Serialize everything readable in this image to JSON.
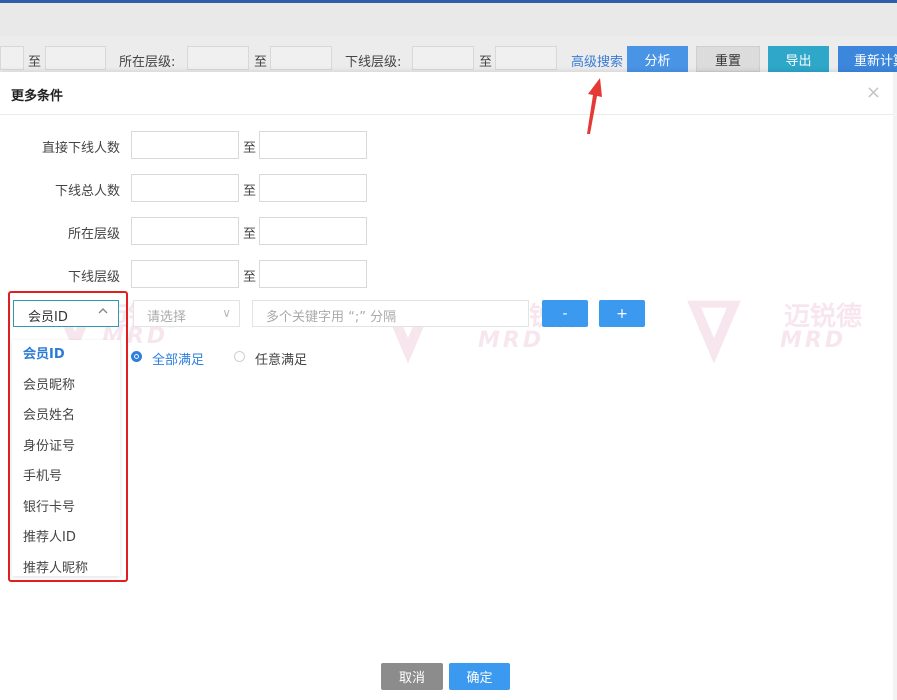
{
  "filter_bar": {
    "sep1": "至",
    "level_label": "所在层级:",
    "sep2": "至",
    "downline_level_label": "下线层级:",
    "sep3": "至",
    "advanced_search": "高级搜索",
    "analyze": "分析",
    "reset": "重置",
    "export": "导出",
    "recalc": "重新计算"
  },
  "modal": {
    "title": "更多条件",
    "close_icon": "×",
    "rows": [
      {
        "label": "直接下线人数",
        "sep": "至"
      },
      {
        "label": "下线总人数",
        "sep": "至"
      },
      {
        "label": "所在层级",
        "sep": "至"
      },
      {
        "label": "下线层级",
        "sep": "至"
      }
    ],
    "field_select": {
      "value": "会员ID",
      "icon": "chevron-up-icon"
    },
    "op_select": {
      "placeholder": "请选择"
    },
    "keyword_input": {
      "placeholder": "多个关键字用 “;” 分隔"
    },
    "remove_btn": "-",
    "add_btn": "+",
    "match_all": "全部满足",
    "match_any": "任意满足",
    "dropdown_options": [
      "会员ID",
      "会员昵称",
      "会员姓名",
      "身份证号",
      "手机号",
      "银行卡号",
      "推荐人ID",
      "推荐人昵称"
    ],
    "cancel": "取消",
    "confirm": "确定"
  },
  "watermark": {
    "brand": "迈锐德",
    "latin": "MRD"
  },
  "colors": {
    "accent": "#3c99f0",
    "teal": "#2ea7c9",
    "highlight": "#e02020",
    "cancel_gray": "#8c8c8c"
  }
}
